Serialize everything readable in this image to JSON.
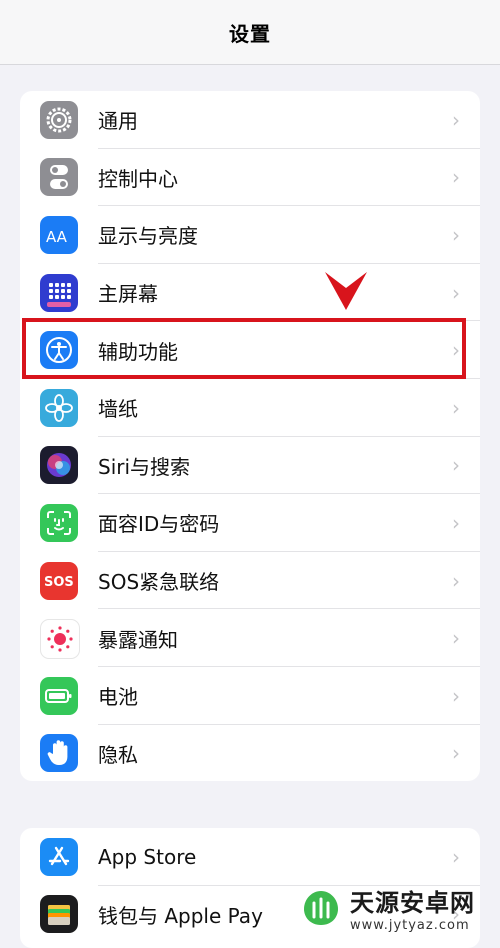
{
  "navbar": {
    "title": "设置"
  },
  "group1": [
    {
      "name": "general",
      "label": "通用",
      "icon": "gear-icon",
      "color": "#8e8e93"
    },
    {
      "name": "control-center",
      "label": "控制中心",
      "icon": "toggles-icon",
      "color": "#8e8e93"
    },
    {
      "name": "display-brightness",
      "label": "显示与亮度",
      "icon": "text-size-icon",
      "color": "#1b7cf5"
    },
    {
      "name": "home-screen",
      "label": "主屏幕",
      "icon": "app-grid-icon",
      "color": "#2f3ccf"
    },
    {
      "name": "accessibility",
      "label": "辅助功能",
      "icon": "accessibility-icon",
      "color": "#1b7cf5"
    },
    {
      "name": "wallpaper",
      "label": "墙纸",
      "icon": "flower-icon",
      "color": "#37aadc"
    },
    {
      "name": "siri-search",
      "label": "Siri与搜索",
      "icon": "siri-icon",
      "color": "#1c1c2e"
    },
    {
      "name": "face-id",
      "label": "面容ID与密码",
      "icon": "face-id-icon",
      "color": "#34c759"
    },
    {
      "name": "emergency-sos",
      "label": "SOS紧急联络",
      "icon": "sos-icon",
      "color": "#e8352f"
    },
    {
      "name": "exposure",
      "label": "暴露通知",
      "icon": "exposure-icon",
      "color": "#ffffff"
    },
    {
      "name": "battery",
      "label": "电池",
      "icon": "battery-icon",
      "color": "#34c759"
    },
    {
      "name": "privacy",
      "label": "隐私",
      "icon": "hand-icon",
      "color": "#1b7cf5"
    }
  ],
  "group2": [
    {
      "name": "app-store",
      "label": "App Store",
      "icon": "app-store-icon",
      "color": "#1b8cf5"
    },
    {
      "name": "wallet",
      "label": "钱包与 Apple Pay",
      "icon": "wallet-icon",
      "color": "#1c1c1e"
    }
  ],
  "chevron": "›",
  "highlight_color": "#d8141c",
  "watermark": {
    "title": "天源安卓网",
    "url": "www.jytyaz.com"
  }
}
